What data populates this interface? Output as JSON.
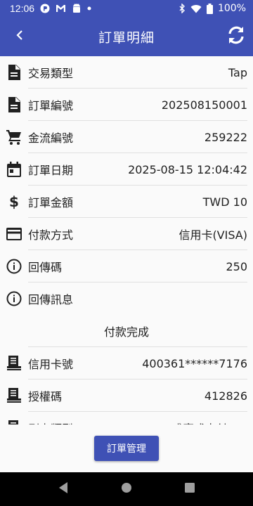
{
  "status_bar": {
    "time": "12:06",
    "battery": "100%",
    "icons": [
      "app-badge-icon",
      "gmail-icon",
      "android-icon",
      "notification-dot-icon",
      "bluetooth-icon",
      "wifi-icon",
      "battery-icon"
    ]
  },
  "app_bar": {
    "title": "訂單明細",
    "back_icon": "chevron-left-icon",
    "refresh_icon": "refresh-icon"
  },
  "details": [
    {
      "label": "交易類型",
      "value": "Tap",
      "icon": "document-icon"
    },
    {
      "label": "訂單編號",
      "value": "202508150001",
      "icon": "document-icon"
    },
    {
      "label": "金流編號",
      "value": "259222",
      "icon": "cart-icon"
    },
    {
      "label": "訂單日期",
      "value": "2025-08-15 12:04:42",
      "icon": "calendar-icon"
    },
    {
      "label": "訂單金額",
      "value": "TWD 10",
      "icon": "dollar-icon"
    },
    {
      "label": "付款方式",
      "value": "信用卡(VISA)",
      "icon": "credit-card-icon"
    },
    {
      "label": "回傳碼",
      "value": "250",
      "icon": "info-icon"
    },
    {
      "label": "回傳訊息",
      "value": "",
      "icon": "info-icon"
    }
  ],
  "section_title": "付款完成",
  "payment_details": [
    {
      "label": "信用卡號",
      "value": "400361******7176",
      "icon": "receipt-icon"
    },
    {
      "label": "授權碼",
      "value": "412826",
      "icon": "receipt-icon"
    },
    {
      "label": "刷卡類型",
      "value": "感應式支付(W)",
      "icon": "receipt-icon"
    }
  ],
  "action_button": {
    "label": "訂單管理"
  },
  "colors": {
    "primary": "#3f51b5",
    "divider": "#e0e0e0",
    "nav_bar": "#000000"
  }
}
